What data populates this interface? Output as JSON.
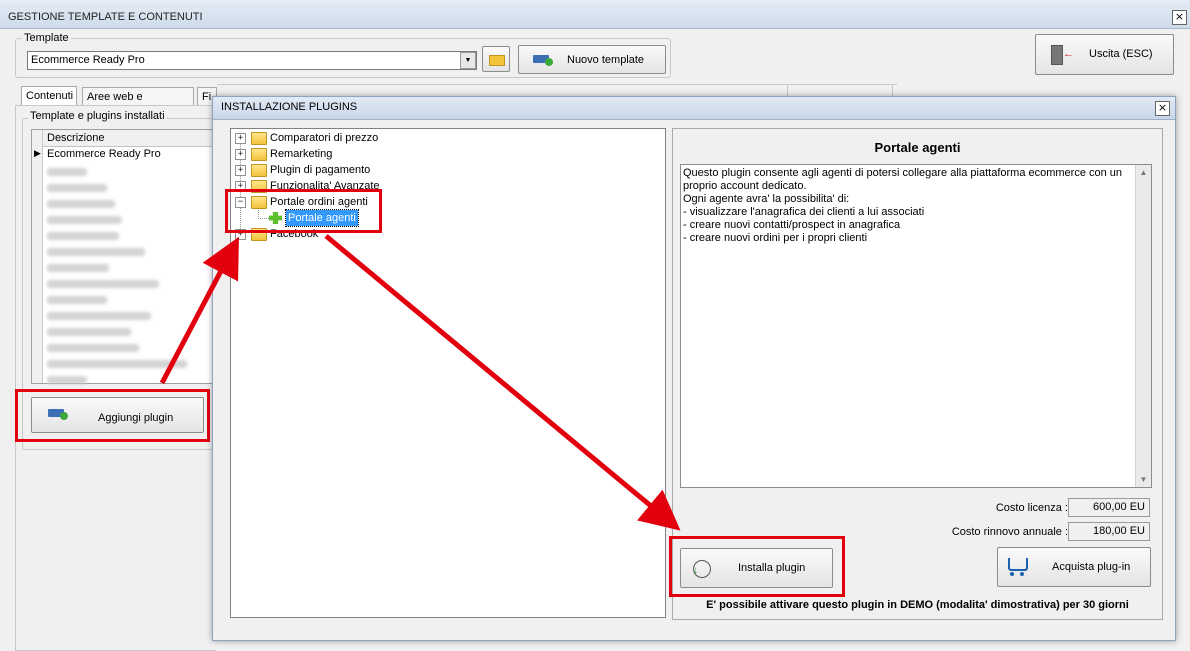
{
  "window": {
    "title": "GESTIONE TEMPLATE E CONTENUTI",
    "close_glyph": "×"
  },
  "template_group": {
    "label": "Template",
    "selected": "Ecommerce Ready Pro",
    "new_button": "Nuovo template"
  },
  "exit_button": "Uscita (ESC)",
  "tabs": [
    "Contenuti",
    "Aree web e categorie",
    "Fi"
  ],
  "installed_group": {
    "label": "Template e plugins installati",
    "column_header": "Descrizione",
    "rows": [
      "Ecommerce Ready Pro"
    ],
    "add_button": "Aggiungi plugin"
  },
  "dialog": {
    "title": "INSTALLAZIONE PLUGINS",
    "close_glyph": "×",
    "tree": [
      {
        "label": "Comparatori di prezzo",
        "expander": "+"
      },
      {
        "label": "Remarketing",
        "expander": "+"
      },
      {
        "label": "Plugin di pagamento",
        "expander": "+"
      },
      {
        "label": "Funzionalita' Avanzate",
        "expander": "+"
      },
      {
        "label": "Portale ordini agenti",
        "expander": "−"
      },
      {
        "label": "Portale agenti",
        "child": true,
        "selected": true
      },
      {
        "label": "Facebook",
        "expander": "+"
      }
    ],
    "plugin": {
      "name": "Portale agenti",
      "description": "Questo plugin consente agli agenti di potersi collegare alla piattaforma ecommerce con un proprio account dedicato.\nOgni agente avra' la possibilita' di:\n- visualizzare l'anagrafica dei clienti a lui associati\n- creare nuovi contatti/prospect in anagrafica\n- creare nuovi ordini per i propri clienti",
      "license_label": "Costo licenza :",
      "license_value": "600,00 EU",
      "renewal_label": "Costo rinnovo annuale :",
      "renewal_value": "180,00 EU",
      "install_button": "Installa plugin",
      "buy_button": "Acquista plug-in",
      "demo_note": "E' possibile attivare questo plugin in DEMO (modalita' dimostrativa) per 30 giorni"
    }
  },
  "colors": {
    "highlight": "#e2000e",
    "selection": "#3399ff"
  }
}
